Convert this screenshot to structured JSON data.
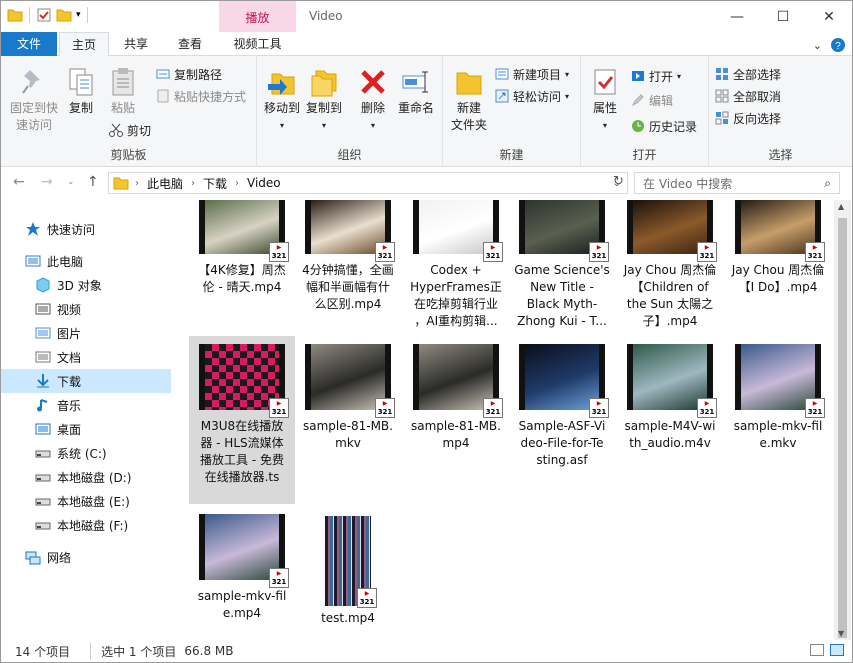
{
  "window": {
    "title": "Video",
    "context_tab": "播放"
  },
  "tabs": [
    {
      "label": "文件"
    },
    {
      "label": "主页"
    },
    {
      "label": "共享"
    },
    {
      "label": "查看"
    },
    {
      "label": "视频工具"
    }
  ],
  "ribbon": {
    "clipboard": {
      "pin": "固定到快速访问",
      "pin1": "固定到快",
      "pin2": "速访问",
      "copy": "复制",
      "paste": "粘贴",
      "copy_path": "复制路径",
      "paste_shortcut": "粘贴快捷方式",
      "cut": "剪切",
      "label": "剪贴板"
    },
    "organize": {
      "move_to": "移动到",
      "copy_to": "复制到",
      "delete": "删除",
      "rename": "重命名",
      "label": "组织"
    },
    "new": {
      "new_folder1": "新建",
      "new_folder2": "文件夹",
      "new_item": "新建项目",
      "easy_access": "轻松访问",
      "label": "新建"
    },
    "open": {
      "properties": "属性",
      "open": "打开",
      "edit": "编辑",
      "history": "历史记录",
      "label": "打开"
    },
    "select": {
      "select_all": "全部选择",
      "select_none": "全部取消",
      "invert": "反向选择",
      "label": "选择"
    }
  },
  "address": {
    "crumbs": [
      "此电脑",
      "下载",
      "Video"
    ],
    "search_placeholder": "在 Video 中搜索"
  },
  "nav": [
    {
      "label": "快速访问",
      "icon": "star-icon"
    },
    {
      "label": "此电脑",
      "icon": "computer-icon"
    },
    {
      "label": "3D 对象",
      "icon": "cube-icon"
    },
    {
      "label": "视频",
      "icon": "video-icon"
    },
    {
      "label": "图片",
      "icon": "picture-icon"
    },
    {
      "label": "文档",
      "icon": "document-icon"
    },
    {
      "label": "下载",
      "icon": "download-icon"
    },
    {
      "label": "音乐",
      "icon": "music-icon"
    },
    {
      "label": "桌面",
      "icon": "desktop-icon"
    },
    {
      "label": "系统 (C:)",
      "icon": "drive-icon"
    },
    {
      "label": "本地磁盘 (D:)",
      "icon": "drive-icon"
    },
    {
      "label": "本地磁盘 (E:)",
      "icon": "drive-icon"
    },
    {
      "label": "本地磁盘 (F:)",
      "icon": "drive-icon"
    },
    {
      "label": "网络",
      "icon": "network-icon"
    }
  ],
  "files": [
    {
      "name": "【4K修复】周杰伦 - 晴天.mp4",
      "l1": "【4K修复】周杰",
      "l2": "伦 - 晴天.mp4"
    },
    {
      "name": "4分钟搞懂，全画幅和半画幅有什么区别.mp4",
      "l1": "4分钟搞懂，全画",
      "l2": "幅和半画幅有什",
      "l3": "么区别.mp4"
    },
    {
      "name": "Codex + HyperFrames正在吃掉剪辑行业，AI重构剪辑...",
      "l1": "Codex +",
      "l2": "HyperFrames正",
      "l3": "在吃掉剪辑行业",
      "l4": "，AI重构剪辑..."
    },
    {
      "name": "Game Science's New Title - Black Myth- Zhong Kui - T...",
      "l1": "Game Science's",
      "l2": "New Title -",
      "l3": "Black Myth-",
      "l4": "Zhong Kui - T..."
    },
    {
      "name": "Jay Chou 周杰倫【Children of the Sun 太陽之子】.mp4",
      "l1": "Jay Chou 周杰倫",
      "l2": "【Children of",
      "l3": "the Sun 太陽之",
      "l4": "子】.mp4"
    },
    {
      "name": "Jay Chou 周杰倫【I Do】.mp4",
      "l1": "Jay Chou 周杰倫",
      "l2": "【I Do】.mp4"
    },
    {
      "name": "M3U8在线播放器 - HLS流媒体播放工具 - 免费在线播放器.ts",
      "l1": "M3U8在线播放",
      "l2": "器 - HLS流媒体",
      "l3": "播放工具 - 免费",
      "l4": "在线播放器.ts"
    },
    {
      "name": "sample-81-MB.mkv",
      "l1": "sample-81-MB.",
      "l2": "mkv"
    },
    {
      "name": "sample-81-MB.mp4",
      "l1": "sample-81-MB.",
      "l2": "mp4"
    },
    {
      "name": "Sample-ASF-Video-File-for-Testing.asf",
      "l1": "Sample-ASF-Vi",
      "l2": "deo-File-for-Te",
      "l3": "sting.asf"
    },
    {
      "name": "sample-M4V-with_audio.m4v",
      "l1": "sample-M4V-wi",
      "l2": "th_audio.m4v"
    },
    {
      "name": "sample-mkv-file.mkv",
      "l1": "sample-mkv-fil",
      "l2": "e.mkv"
    },
    {
      "name": "sample-mkv-file.mp4",
      "l1": "sample-mkv-fil",
      "l2": "e.mp4"
    },
    {
      "name": "test.mp4",
      "l1": "test.mp4"
    }
  ],
  "badge": {
    "top": "321",
    "bottom": "▶"
  },
  "status": {
    "count": "14 个项目",
    "selected": "选中 1 个项目",
    "size": "66.8 MB"
  }
}
